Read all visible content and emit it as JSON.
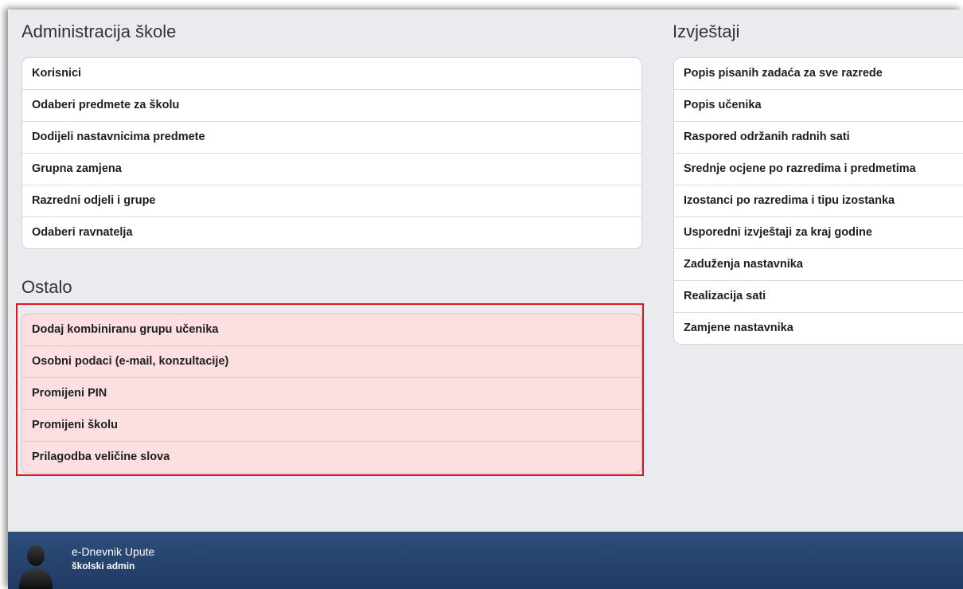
{
  "admin": {
    "title": "Administracija škole",
    "items": [
      "Korisnici",
      "Odaberi predmete za školu",
      "Dodijeli nastavnicima predmete",
      "Grupna zamjena",
      "Razredni odjeli i grupe",
      "Odaberi ravnatelja"
    ]
  },
  "ostalo": {
    "title": "Ostalo",
    "items": [
      "Dodaj kombiniranu grupu učenika",
      "Osobni podaci (e-mail, konzultacije)",
      "Promijeni PIN",
      "Promijeni školu",
      "Prilagodba veličine slova"
    ]
  },
  "reports": {
    "title": "Izvještaji",
    "items": [
      "Popis pisanih zadaća za sve razrede",
      "Popis učenika",
      "Raspored održanih radnih sati",
      "Srednje ocjene po razredima i predmetima",
      "Izostanci po razredima i tipu izostanka",
      "Usporedni izvještaji za kraj godine",
      "Zaduženja nastavnika",
      "Realizacija sati",
      "Zamjene nastavnika"
    ]
  },
  "footer": {
    "app_name": "e-Dnevnik Upute",
    "role": "školski admin"
  },
  "colors": {
    "highlight_border": "#e0141e",
    "highlight_fill": "#fcdfe1",
    "footer_bg": "#2f4e7c"
  }
}
